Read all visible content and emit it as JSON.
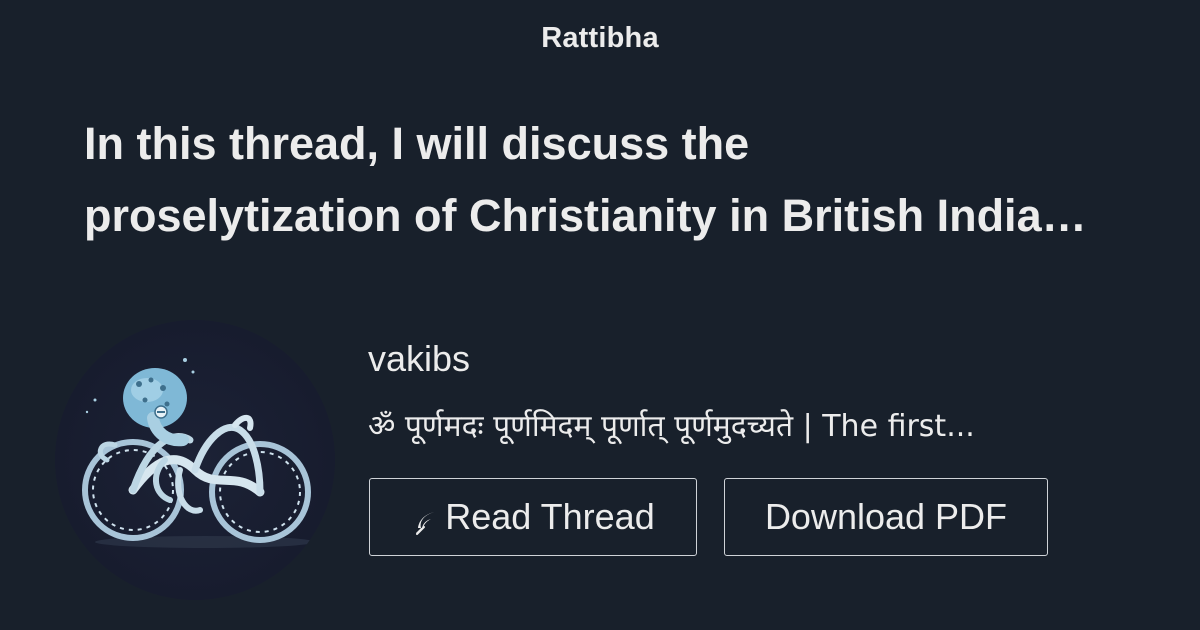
{
  "header": {
    "brand": "Rattibha"
  },
  "thread": {
    "title_line1": "In this thread, I will discuss the",
    "title_line2": "proselytization of Christianity in British India…"
  },
  "author": {
    "name": "vakibs",
    "bio": "ॐ पूर्णमदः पूर्णमिदम् पूर्णात् पूर्णमुदच्यते | The first...",
    "avatar_description_icon": "octopus-bicycle-avatar"
  },
  "actions": {
    "read_label": "Read Thread",
    "read_icon": "feather-icon",
    "pdf_label": "Download PDF"
  },
  "colors": {
    "background": "#18202b",
    "text": "#ececec",
    "button_border": "#cfd3d8"
  }
}
